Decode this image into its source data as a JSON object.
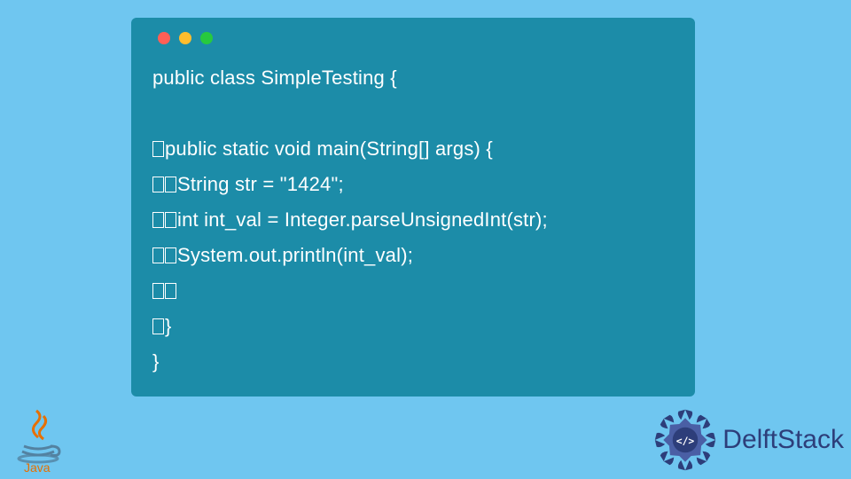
{
  "code": {
    "line1": "public class SimpleTesting {",
    "line2": "",
    "line3_pre_tofu": 1,
    "line3": "public static void main(String[] args) {",
    "line4_pre_tofu": 2,
    "line4": "String str = \"1424\";",
    "line5_pre_tofu": 2,
    "line5": "int int_val = Integer.parseUnsignedInt(str);",
    "line6_pre_tofu": 2,
    "line6": "System.out.println(int_val);",
    "line7_pre_tofu": 2,
    "line7": "",
    "line8_pre_tofu": 1,
    "line8": "}",
    "line9": "}"
  },
  "brand": {
    "java": "Java",
    "delft": "DelftStack"
  }
}
